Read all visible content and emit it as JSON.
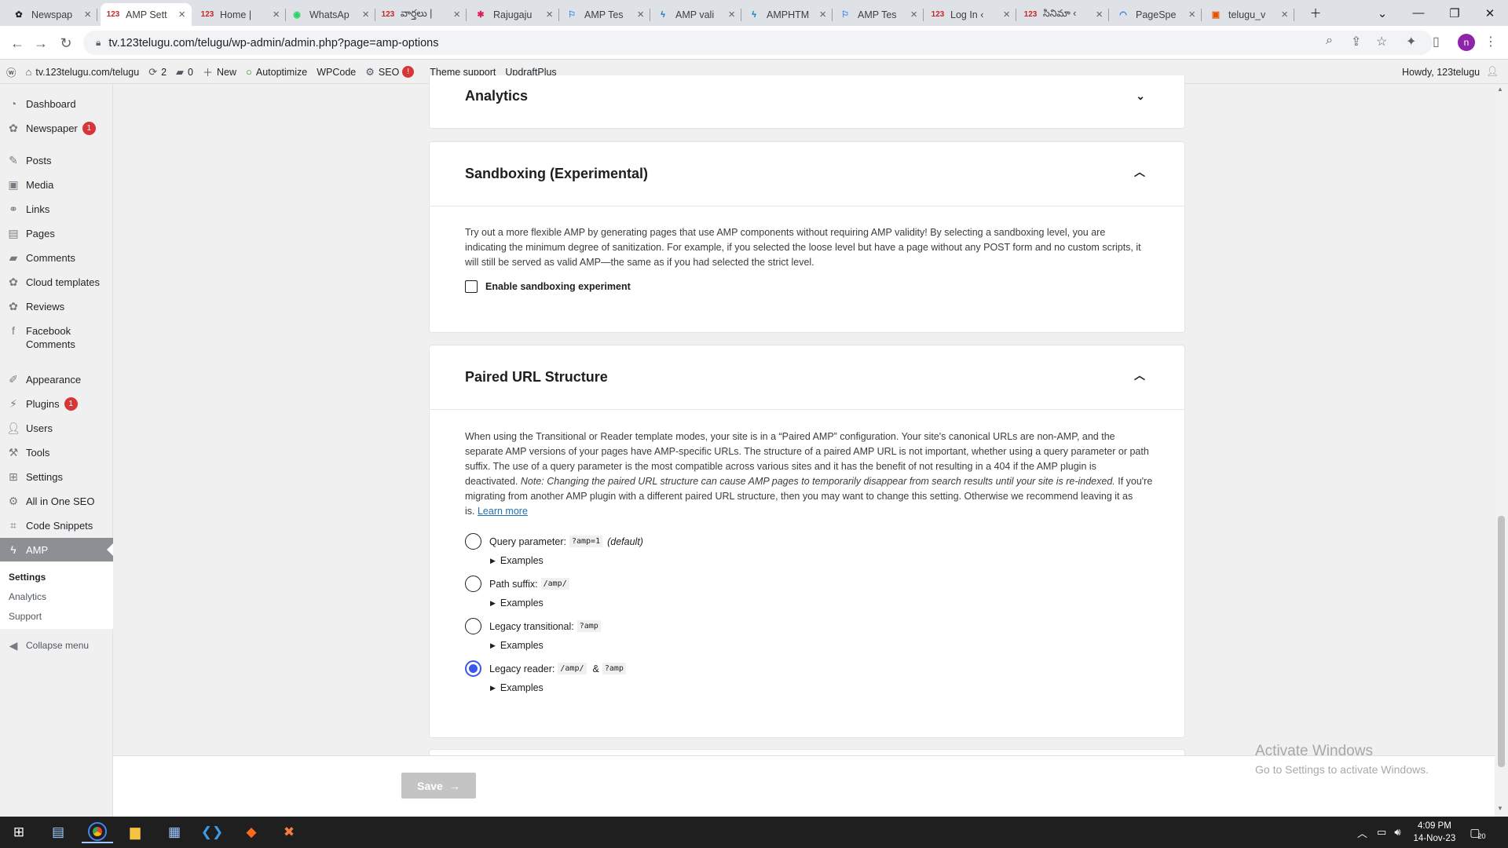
{
  "browser": {
    "tabs": [
      {
        "title": "Newspap",
        "icon": "newspaper-icon",
        "active": false
      },
      {
        "title": "AMP Sett",
        "icon": "123-icon",
        "active": true
      },
      {
        "title": "Home |",
        "icon": "123-icon",
        "active": false
      },
      {
        "title": "WhatsAp",
        "icon": "whatsapp-icon",
        "active": false
      },
      {
        "title": "వార్తలు |",
        "icon": "123-icon",
        "active": false
      },
      {
        "title": "Rajugaju",
        "icon": "slack-icon",
        "active": false
      },
      {
        "title": "AMP Tes",
        "icon": "google-icon",
        "active": false
      },
      {
        "title": "AMP vali",
        "icon": "amp-icon",
        "active": false
      },
      {
        "title": "AMPHTM",
        "icon": "amp-icon",
        "active": false
      },
      {
        "title": "AMP Tes",
        "icon": "google-icon",
        "active": false
      },
      {
        "title": "Log In ‹",
        "icon": "123-icon",
        "active": false
      },
      {
        "title": "సినిమా ‹",
        "icon": "123-icon",
        "active": false
      },
      {
        "title": "PageSpe",
        "icon": "pagespeed-icon",
        "active": false
      },
      {
        "title": "telugu_v",
        "icon": "file-icon",
        "active": false
      }
    ],
    "url": "tv.123telugu.com/telugu/wp-admin/admin.php?page=amp-options"
  },
  "adminbar": {
    "site": "tv.123telugu.com/telugu",
    "updates": "2",
    "comments": "0",
    "new": "New",
    "autoptimize": "Autoptimize",
    "wpcode": "WPCode",
    "seo": "SEO",
    "seo_badge": "!",
    "theme_support": "Theme support",
    "updraft": "UpdraftPlus",
    "howdy": "Howdy, 123telugu"
  },
  "sidebar": {
    "items": [
      {
        "label": "Dashboard",
        "icon": "dashboard-icon"
      },
      {
        "label": "Newspaper",
        "icon": "newspaper-icon",
        "badge": "1"
      },
      {
        "label": "Posts",
        "icon": "pin-icon"
      },
      {
        "label": "Media",
        "icon": "media-icon"
      },
      {
        "label": "Links",
        "icon": "link-icon"
      },
      {
        "label": "Pages",
        "icon": "pages-icon"
      },
      {
        "label": "Comments",
        "icon": "comment-icon"
      },
      {
        "label": "Cloud templates",
        "icon": "cloud-icon"
      },
      {
        "label": "Reviews",
        "icon": "reviews-icon"
      },
      {
        "label": "Facebook",
        "label2": "Comments",
        "icon": "facebook-icon"
      },
      {
        "label": "Appearance",
        "icon": "brush-icon"
      },
      {
        "label": "Plugins",
        "icon": "plugin-icon",
        "badge": "1"
      },
      {
        "label": "Users",
        "icon": "user-icon"
      },
      {
        "label": "Tools",
        "icon": "wrench-icon"
      },
      {
        "label": "Settings",
        "icon": "settings-icon"
      },
      {
        "label": "All in One SEO",
        "icon": "seo-icon"
      },
      {
        "label": "Code Snippets",
        "icon": "code-icon"
      }
    ],
    "current": "AMP",
    "submenu": [
      "Settings",
      "Analytics",
      "Support"
    ],
    "collapse": "Collapse menu"
  },
  "analytics": {
    "title": "Analytics"
  },
  "sandbox": {
    "title": "Sandboxing (Experimental)",
    "desc_lines": [
      "Try out a more flexible AMP by generating pages that use AMP components without requiring AMP validity! By selecting a sandboxing level, you are",
      "indicating the minimum degree of sanitization. For example, if you selected the loose level but have a page without any POST form and no custom scripts, it",
      "will still be served as valid AMP—the same as if you had selected the strict level."
    ],
    "checkbox": "Enable sandboxing experiment"
  },
  "paired": {
    "title": "Paired URL Structure",
    "desc_lines": [
      "When using the Transitional or Reader template modes, your site is in a “Paired AMP” configuration. Your site's canonical URLs are non-AMP, and the",
      "separate AMP versions of your pages have AMP-specific URLs. The structure of a paired AMP URL is not important, whether using a query parameter or path",
      "suffix. The use of a query parameter is the most compatible across various sites and it has the benefit of not resulting in a 404 if the AMP plugin is"
    ],
    "line4_start": "deactivated. ",
    "line4_note": "Note: Changing the paired URL structure can cause AMP pages to temporarily disappear from search results until your site is re-indexed.",
    "line4_end": " If you're",
    "line5": "migrating from another AMP plugin with a different paired URL structure, then you may want to change this setting. Otherwise we recommend leaving it as",
    "line6_start": "is. ",
    "learn_more": "Learn more",
    "options": [
      {
        "label": "Query parameter:",
        "code": "?amp=1",
        "extra": "(default)",
        "selected": false
      },
      {
        "label": "Path suffix:",
        "code": "/amp/",
        "selected": false
      },
      {
        "label": "Legacy transitional:",
        "code": "?amp",
        "selected": false
      },
      {
        "label": "Legacy reader:",
        "code": "/amp/",
        "joiner": "&",
        "code2": "?amp",
        "selected": true
      }
    ],
    "examples": "Examples"
  },
  "save": {
    "label": "Save",
    "arrow": "→"
  },
  "watermark": {
    "title": "Activate Windows",
    "sub": "Go to Settings to activate Windows."
  },
  "taskbar": {
    "time": "4:09 PM",
    "date": "14-Nov-23",
    "notif": "20"
  },
  "colors": {
    "accent": "#3858e9",
    "link": "#2271b1",
    "badge": "#d63638"
  }
}
